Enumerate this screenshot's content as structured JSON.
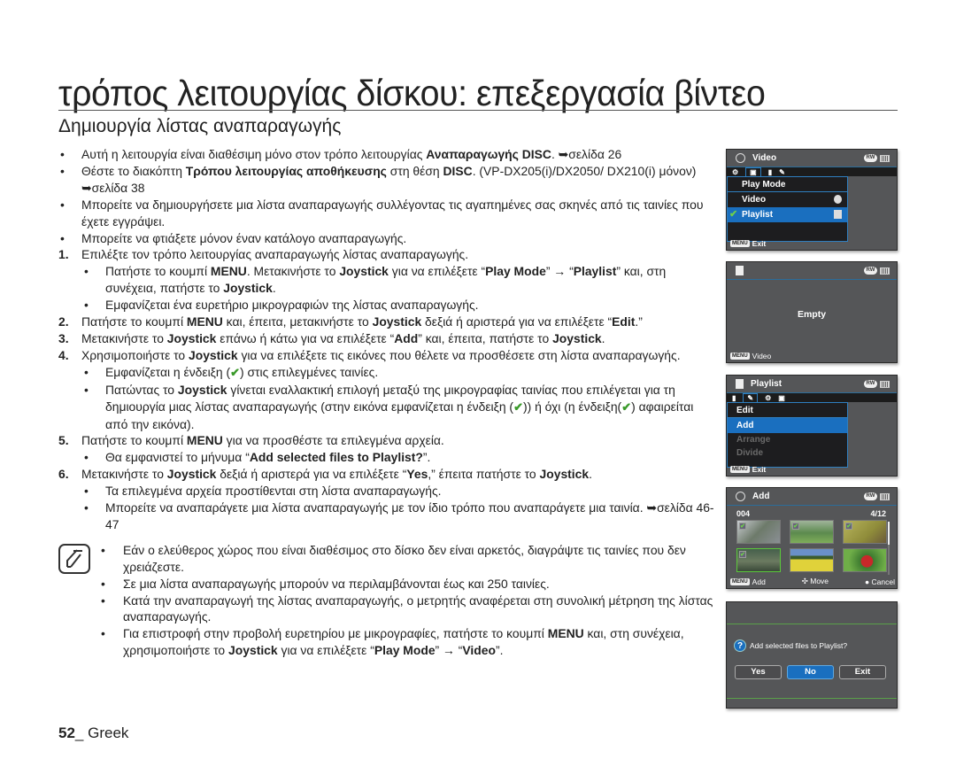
{
  "page": {
    "title": "τρόπος λειτουργίας δίσκου: επεξεργασία βίντεο",
    "subtitle": "Δημιουργία λίστας αναπαραγωγής",
    "footer_num": "52",
    "footer_sep": "_",
    "footer_lang": " Greek"
  },
  "intro": [
    {
      "parts": [
        "Αυτή η λειτουργία είναι διαθέσιμη μόνο στον τρόπο λειτουργίας ",
        "Αναπαραγωγής DISC",
        ". ➥σελίδα 26"
      ]
    },
    {
      "parts": [
        "Θέστε το διακόπτη ",
        "Τρόπου λειτουργίας αποθήκευσης",
        " στη θέση ",
        "DISC",
        ". (VP-DX205(i)/DX2050/ DX210(i) μόνον) ➥σελίδα 38"
      ]
    },
    {
      "text": "Μπορείτε να δημιουργήσετε μια λίστα αναπαραγωγής συλλέγοντας τις αγαπημένες σας σκηνές από τις ταινίες που έχετε εγγράψει."
    },
    {
      "text": "Μπορείτε να φτιάξετε μόνον έναν κατάλογο αναπαραγωγής."
    }
  ],
  "steps": {
    "s1": {
      "num": "1.",
      "text": "Επιλέξτε τον τρόπο λειτουργίας αναπαραγωγής λίστας αναπαραγωγής."
    },
    "s1a": [
      "Πατήστε το κουμπί ",
      "MENU",
      ". Μετακινήστε το ",
      "Joystick",
      " για να επιλέξετε “",
      "Play Mode",
      "” → “",
      "Playlist",
      "” και, στη συνέχεια, πατήστε το ",
      "Joystick",
      "."
    ],
    "s1b": "Εμφανίζεται ένα ευρετήριο μικρογραφιών της λίστας αναπαραγωγής.",
    "s2": {
      "num": "2.",
      "parts": [
        "Πατήστε το κουμπί ",
        "MENU",
        " και, έπειτα, μετακινήστε το ",
        "Joystick",
        " δεξιά ή αριστερά για να επιλέξετε “",
        "Edit",
        ".”"
      ]
    },
    "s3": {
      "num": "3.",
      "parts": [
        "Μετακινήστε το ",
        "Joystick",
        " επάνω ή κάτω για να επιλέξετε “",
        "Add",
        "” και, έπειτα, πατήστε το ",
        "Joystick",
        "."
      ]
    },
    "s4": {
      "num": "4.",
      "parts": [
        "Χρησιμοποιήστε το ",
        "Joystick",
        " για να επιλέξετε τις εικόνες που θέλετε να προσθέσετε στη λίστα αναπαραγωγής."
      ]
    },
    "s4a": [
      "Εμφανίζεται η ένδειξη (",
      ") στις επιλεγμένες ταινίες."
    ],
    "s4b": [
      "Πατώντας το ",
      "Joystick",
      " γίνεται εναλλακτική επιλογή μεταξύ της μικρογραφίας ταινίας που επιλέγεται για τη δημιουργία μιας λίστας αναπαραγωγής (στην εικόνα εμφανίζεται η ένδειξη (",
      ")) ή όχι (η ένδειξη(",
      ") αφαιρείται από την εικόνα)."
    ],
    "s5": {
      "num": "5.",
      "parts": [
        "Πατήστε το κουμπί ",
        "MENU",
        " για να προσθέστε τα επιλεγμένα αρχεία."
      ]
    },
    "s5a": [
      "Θα εμφανιστεί το μήνυμα “",
      "Add selected files to Playlist?",
      "”."
    ],
    "s6": {
      "num": "6.",
      "parts": [
        "Μετακινήστε το ",
        "Joystick",
        " δεξιά ή αριστερά για να επιλέξετε “",
        "Yes",
        ",” έπειτα πατήστε το ",
        "Joystick",
        "."
      ]
    },
    "s6a": "Τα επιλεγμένα αρχεία προστίθενται στη λίστα αναπαραγωγής.",
    "s6b": "Μπορείτε να αναπαράγετε μια λίστα αναπαραγωγής με τον ίδιο τρόπο που αναπαράγετε μια ταινία. ➥σελίδα 46-47"
  },
  "notes": {
    "n1": "Εάν ο ελεύθερος χώρος που είναι διαθέσιμος στο δίσκο δεν είναι αρκετός, διαγράψτε τις ταινίες που δεν χρειάζεστε.",
    "n2": "Σε μια λίστα αναπαραγωγής μπορούν να περιλαμβάνονται έως και 250 ταινίες.",
    "n3": "Κατά την αναπαραγωγή της λίστας αναπαραγωγής, ο μετρητής αναφέρεται στη συνολική μέτρηση της λίστας αναπαραγωγής.",
    "n4": [
      "Για επιστροφή στην προβολή ευρετηρίου με μικρογραφίες, πατήστε το κουμπί ",
      "MENU",
      " και, στη συνέχεια, χρησιμοποιήστε το ",
      "Joystick",
      " για να επιλέξετε “",
      "Play Mode",
      "” → “",
      "Video",
      "”."
    ]
  },
  "bullet": "•",
  "check_glyph": "✔",
  "screens": {
    "s1": {
      "header": "Video",
      "menu_title": "Play Mode",
      "items": [
        "Video",
        "Playlist"
      ],
      "footer_key": "MENU",
      "footer": "Exit"
    },
    "s2": {
      "empty": "Empty",
      "footer_key": "MENU",
      "footer": "Video"
    },
    "s3": {
      "header": "Playlist",
      "menu_title": "Edit",
      "items": [
        "Add",
        "Arrange",
        "Divide"
      ],
      "footer_key": "MENU",
      "footer": "Exit"
    },
    "s4": {
      "header": "Add",
      "counter_left": "004",
      "counter_right": "4/12",
      "footer_key": "MENU",
      "footer_add": "Add",
      "footer_move": "Move",
      "footer_cancel": "Cancel"
    },
    "s5": {
      "message": "Add selected files to Playlist?",
      "buttons": [
        "Yes",
        "No",
        "Exit"
      ],
      "selected": "No"
    }
  },
  "colors": {
    "highlight": "#1a6fbf",
    "check": "#3a9a2a",
    "screen_bg": "#555658"
  }
}
